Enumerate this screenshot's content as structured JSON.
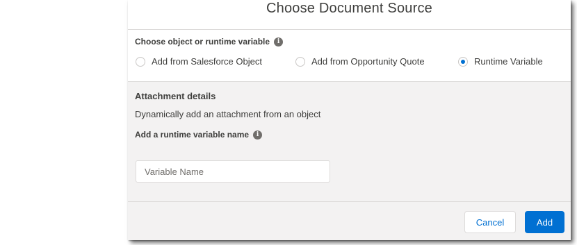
{
  "modal": {
    "title": "Choose Document Source"
  },
  "source": {
    "label": "Choose object or runtime variable",
    "info_icon": "info-icon",
    "options": [
      {
        "label": "Add from Salesforce Object",
        "selected": false
      },
      {
        "label": "Add from Opportunity Quote",
        "selected": false
      },
      {
        "label": "Runtime Variable",
        "selected": true
      }
    ]
  },
  "attachment": {
    "title": "Attachment details",
    "description": "Dynamically add an attachment from an object",
    "variable_label": "Add a runtime variable name",
    "variable_placeholder": "Variable Name",
    "variable_value": ""
  },
  "footer": {
    "cancel_label": "Cancel",
    "add_label": "Add"
  },
  "colors": {
    "brand": "#0070d2",
    "panel_bg": "#f3f2f2",
    "text": "#3e3e3c"
  }
}
